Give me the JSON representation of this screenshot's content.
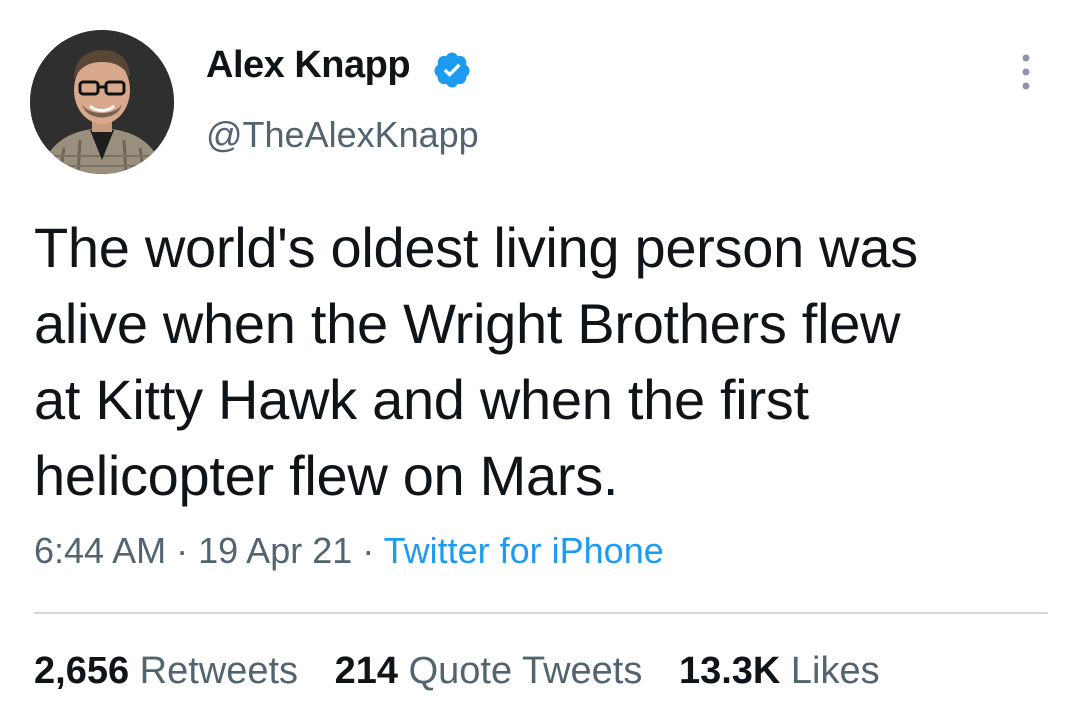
{
  "author": {
    "name": "Alex Knapp",
    "handle": "@TheAlexKnapp",
    "verified": true,
    "verified_color": "#1d9bf0"
  },
  "tweet": {
    "text": "The world's oldest living person was\nalive when the Wright Brothers flew\nat Kitty Hawk and when the first\nhelicopter flew on Mars.",
    "time": "6:44 AM",
    "date": "19 Apr 21",
    "separator": "·",
    "source": "Twitter for iPhone"
  },
  "stats": {
    "retweets_count": "2,656",
    "retweets_label": "Retweets",
    "quotes_count": "214",
    "quotes_label": "Quote Tweets",
    "likes_count": "13.3K",
    "likes_label": "Likes"
  },
  "colors": {
    "text": "#0f1419",
    "secondary": "#536471",
    "link": "#1d9bf0",
    "divider": "#cfd9de"
  },
  "icons": {
    "verified": "verified-badge-icon",
    "more": "more-vertical-icon"
  }
}
